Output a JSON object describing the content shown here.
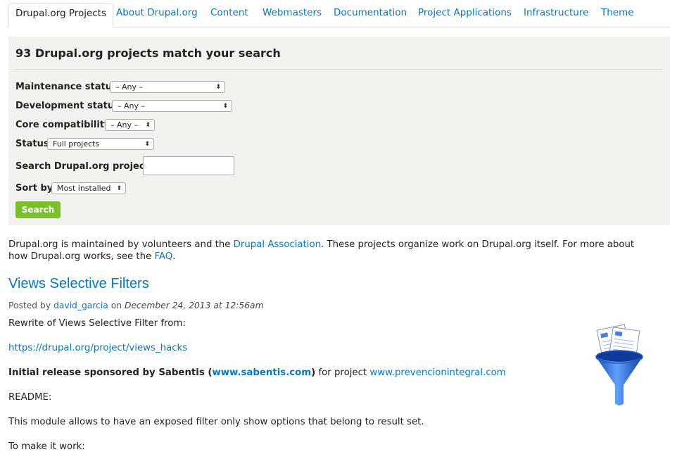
{
  "tabs": [
    {
      "label": "Drupal.org Projects",
      "active": true
    },
    {
      "label": "About Drupal.org"
    },
    {
      "label": "Content"
    },
    {
      "label": "Webmasters"
    },
    {
      "label": "Documentation"
    },
    {
      "label": "Project Applications"
    },
    {
      "label": "Infrastructure"
    },
    {
      "label": "Theme"
    }
  ],
  "filter": {
    "heading": "93 Drupal.org projects match your search",
    "maintenance": {
      "label": "Maintenance status",
      "value": "– Any –"
    },
    "development": {
      "label": "Development status",
      "value": "– Any –"
    },
    "core": {
      "label": "Core compatibility",
      "value": "– Any –"
    },
    "status": {
      "label": "Status",
      "value": "Full projects"
    },
    "search": {
      "label": "Search Drupal.org projects",
      "value": ""
    },
    "sort": {
      "label": "Sort by",
      "value": "Most installed"
    },
    "button": "Search"
  },
  "intro": {
    "part1": "Drupal.org is maintained by volunteers and the ",
    "link1": "Drupal Association",
    "part2": ". These projects organize work on Drupal.org itself. For more about how Drupal.org works, see the ",
    "link2": "FAQ",
    "part3": "."
  },
  "project": {
    "title": "Views Selective Filters",
    "posted_by": "Posted by ",
    "author": "david_garcia",
    "on": " on ",
    "date": "December 24, 2013 at 12:56am",
    "line1": "Rewrite of Views Selective Filter from:",
    "url": "https://drupal.org/project/views_hacks",
    "sponsor_bold": "Initial release sponsored by Sabentis (",
    "sponsor_link": "www.sabentis.com",
    "sponsor_close": ")",
    "sponsor_rest": " for project ",
    "project_link": "www.prevencionintegral.com",
    "readme": "README:",
    "desc": "This module allows to have an exposed filter only show options that belong to result set.",
    "howto": "To make it work:"
  },
  "icons": {
    "project_logo": "funnel-document-icon",
    "select_arrow": "updown-arrow-icon"
  }
}
